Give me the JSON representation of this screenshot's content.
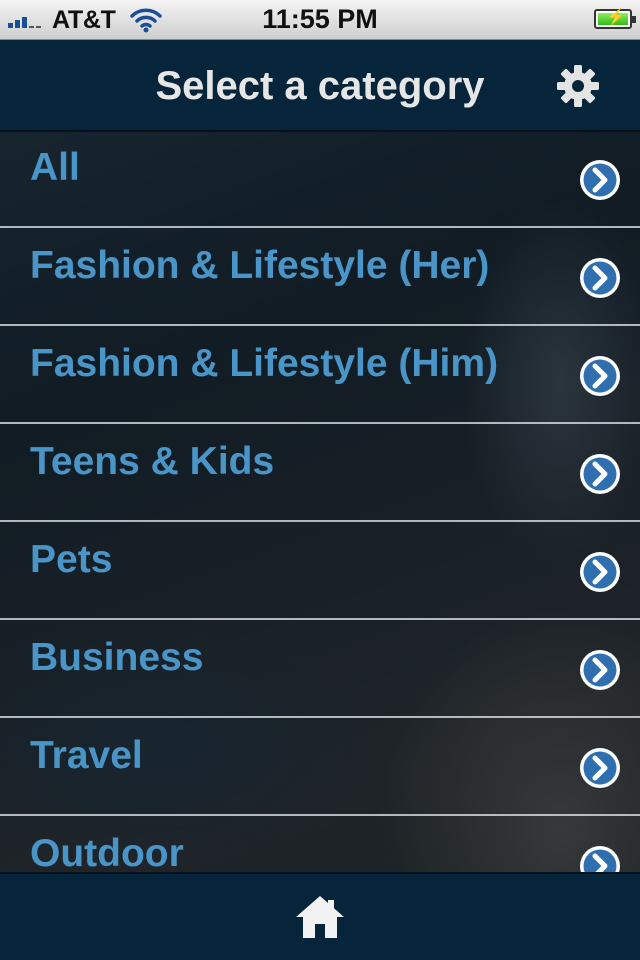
{
  "status_bar": {
    "carrier": "AT&T",
    "time": "11:55 PM",
    "icons": [
      "signal-icon",
      "wifi-icon",
      "battery-charging-icon"
    ]
  },
  "nav_bar": {
    "title": "Select a category",
    "settings_icon": "gear-icon"
  },
  "categories": [
    {
      "label": "All"
    },
    {
      "label": "Fashion & Lifestyle (Her)"
    },
    {
      "label": "Fashion & Lifestyle (Him)"
    },
    {
      "label": "Teens & Kids"
    },
    {
      "label": "Pets"
    },
    {
      "label": "Business"
    },
    {
      "label": "Travel"
    },
    {
      "label": "Outdoor"
    }
  ],
  "row_icon": "chevron-right-circle-icon",
  "bottom_bar": {
    "home_icon": "home-icon"
  },
  "colors": {
    "bar_background": "#07253a",
    "category_text": "#4a95c8",
    "title_text": "#e6e6e6",
    "arrow_button": "#2f6fb0"
  }
}
